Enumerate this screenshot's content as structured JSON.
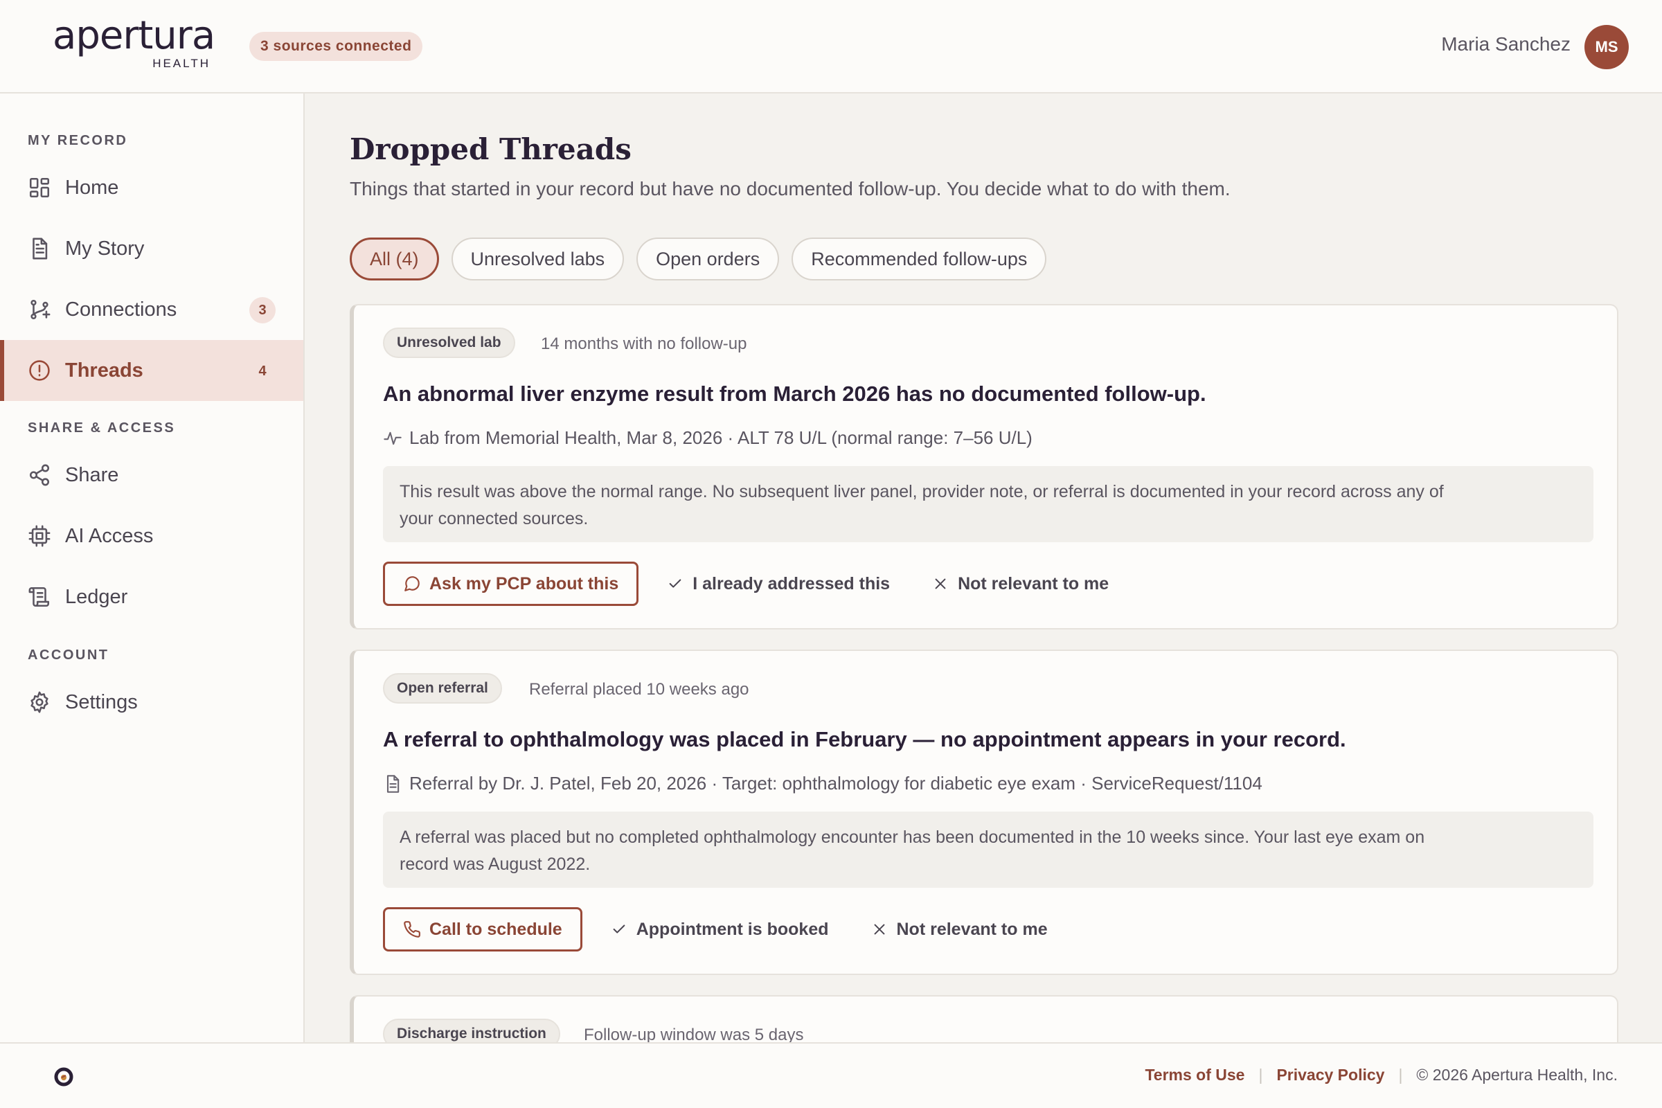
{
  "header": {
    "logo_word": "apertura",
    "logo_sub": "HEALTH",
    "sources_pill": "3 sources connected",
    "user_name": "Maria Sanchez",
    "avatar_initials": "MS"
  },
  "sidebar": {
    "sections": [
      {
        "label": "MY RECORD"
      },
      {
        "label": "SHARE & ACCESS"
      },
      {
        "label": "ACCOUNT"
      }
    ],
    "items": [
      {
        "label": "Home",
        "icon": "grid-icon"
      },
      {
        "label": "My Story",
        "icon": "document-icon"
      },
      {
        "label": "Connections",
        "icon": "branch-icon",
        "badge": "3"
      },
      {
        "label": "Threads",
        "icon": "alert-circle-icon",
        "badge": "4",
        "active": true
      },
      {
        "label": "Share",
        "icon": "share-icon"
      },
      {
        "label": "AI Access",
        "icon": "chip-icon"
      },
      {
        "label": "Ledger",
        "icon": "scroll-icon"
      },
      {
        "label": "Settings",
        "icon": "gear-icon"
      }
    ]
  },
  "main": {
    "title": "Dropped Threads",
    "subtitle": "Things that started in your record but have no documented follow-up. You decide what to do with them.",
    "filters": [
      "All (4)",
      "Unresolved labs",
      "Open orders",
      "Recommended follow-ups"
    ],
    "active_filter": "All (4)",
    "cards": [
      {
        "tag": "Unresolved lab",
        "meta": "14 months with no follow-up",
        "title": "An abnormal liver enzyme result from March 2026 has no documented follow-up.",
        "source": "Lab from Memorial Health, Mar 8, 2026 · ALT 78 U/L (normal range: 7–56 U/L)",
        "source_icon": "pulse-icon",
        "note_line1": "This result was above the normal range. No subsequent liver panel, provider note, or referral is documented in your record across any of",
        "note_line2": "your connected sources.",
        "primary_action": "Ask my PCP about this",
        "primary_icon": "chat-bubble-icon",
        "secondary_action": "I already addressed this",
        "dismiss_action": "Not relevant to me"
      },
      {
        "tag": "Open referral",
        "meta": "Referral placed 10 weeks ago",
        "title": "A referral to ophthalmology was placed in February — no appointment appears in your record.",
        "source": "Referral by Dr. J. Patel, Feb 20, 2026 · Target: ophthalmology for diabetic eye exam · ServiceRequest/1104",
        "source_icon": "document-icon",
        "note_line1": "A referral was placed but no completed ophthalmology encounter has been documented in the 10 weeks since. Your last eye exam on",
        "note_line2": "record was August 2022.",
        "primary_action": "Call to schedule",
        "primary_icon": "phone-icon",
        "secondary_action": "Appointment is booked",
        "dismiss_action": "Not relevant to me"
      },
      {
        "tag": "Discharge instruction",
        "meta": "Follow-up window was 5 days"
      }
    ]
  },
  "footer": {
    "terms": "Terms of Use",
    "privacy": "Privacy Policy",
    "copyright": "© 2026 Apertura Health, Inc."
  },
  "colors": {
    "accent": "#9a4a38",
    "accent_bg": "#f3e1dc",
    "page_bg": "#f4f2ee",
    "surface": "#fcfbf9"
  }
}
